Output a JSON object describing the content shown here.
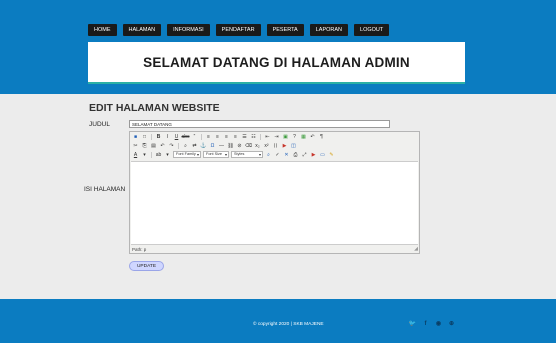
{
  "nav": {
    "items": [
      "HOME",
      "HALAMAN",
      "INFORMASI",
      "PENDAFTAR",
      "PESERTA",
      "LAPORAN",
      "LOGOUT"
    ]
  },
  "banner": {
    "title": "SELAMAT DATANG DI HALAMAN ADMIN"
  },
  "page": {
    "title": "EDIT HALAMAN WEBSITE"
  },
  "form": {
    "judul_label": "JUDUL",
    "judul_value": "SELAMAT DATANG",
    "isi_label": "ISI HALAMAN",
    "font_family": "Font Family",
    "font_size": "Font Size",
    "styles": "Styles",
    "path_label": "Path: p",
    "update_label": "UPDATE"
  },
  "footer": {
    "copyright": "© copyright 2020 | SKB MAJENE"
  },
  "colors": {
    "header": "#0b7cc1",
    "footer": "#0b7cc1",
    "banner_accent": "#2bb0a5"
  }
}
